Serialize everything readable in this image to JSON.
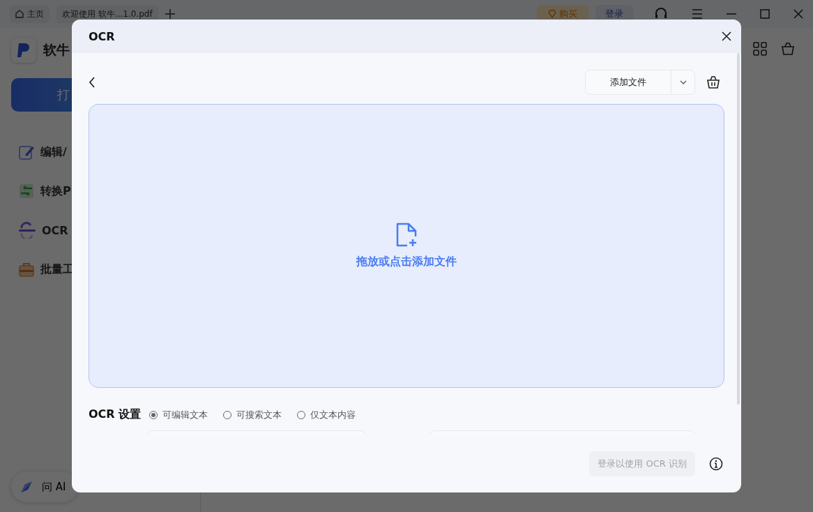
{
  "titlebar": {
    "tabs": [
      {
        "label": "主页",
        "kind": "home"
      },
      {
        "label": "欢迎使用 软牛...1.0.pdf",
        "kind": "doc"
      }
    ],
    "buy": "购买",
    "login": "登录"
  },
  "sidebar": {
    "brand": "软牛",
    "open_button": "打",
    "items": [
      {
        "label": "编辑/",
        "kind": "edit"
      },
      {
        "label": "转换P",
        "kind": "convert"
      },
      {
        "label": "OCR",
        "kind": "ocr"
      },
      {
        "label": "批量工",
        "kind": "batch"
      }
    ],
    "ask_ai": "问 AI"
  },
  "dialog": {
    "title": "OCR",
    "add_file": "添加文件",
    "dropzone": "拖放或点击添加文件",
    "settings_label": "OCR 设置",
    "modes": [
      {
        "label": "可编辑文本",
        "selected": true
      },
      {
        "label": "可搜索文本",
        "selected": false
      },
      {
        "label": "仅文本内容",
        "selected": false
      }
    ],
    "submit": {
      "label": "登录以使用 OCR 识别",
      "disabled": true
    }
  }
}
